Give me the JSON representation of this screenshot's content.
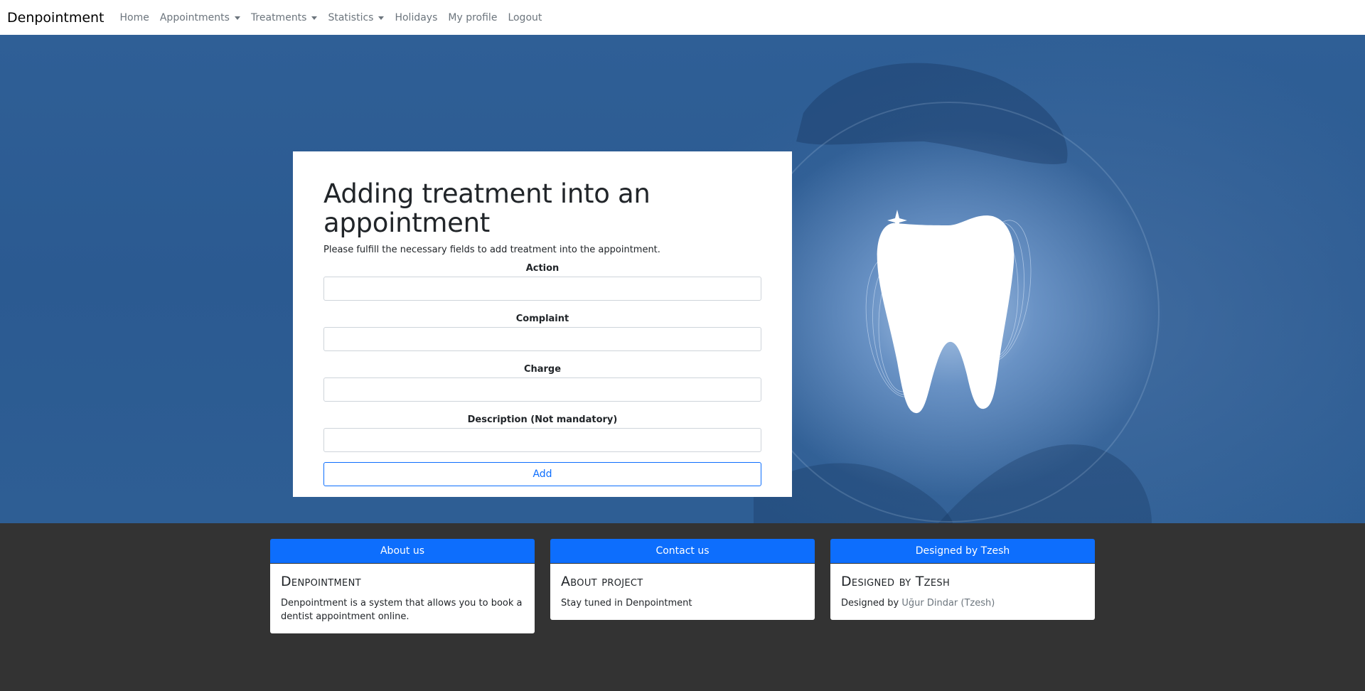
{
  "navbar": {
    "brand": "Denpointment",
    "items": [
      {
        "label": "Home",
        "dropdown": false
      },
      {
        "label": "Appointments",
        "dropdown": true
      },
      {
        "label": "Treatments",
        "dropdown": true
      },
      {
        "label": "Statistics",
        "dropdown": true
      },
      {
        "label": "Holidays",
        "dropdown": false
      },
      {
        "label": "My profile",
        "dropdown": false
      },
      {
        "label": "Logout",
        "dropdown": false
      }
    ]
  },
  "form": {
    "title": "Adding treatment into an appointment",
    "subtitle": "Please fulfill the necessary fields to add treatment into the appointment.",
    "fields": [
      {
        "label": "Action",
        "value": ""
      },
      {
        "label": "Complaint",
        "value": ""
      },
      {
        "label": "Charge",
        "value": ""
      },
      {
        "label": "Description (Not mandatory)",
        "value": ""
      }
    ],
    "submit_label": "Add"
  },
  "footer": {
    "cards": [
      {
        "header": "About us",
        "title": "Denpointment",
        "text": "Denpointment is a system that allows you to book a dentist appointment online."
      },
      {
        "header": "Contact us",
        "title": "About project",
        "text": "Stay tuned in Denpointment"
      },
      {
        "header": "Designed by Tzesh",
        "title": "Designed by Tzesh",
        "text_prefix": "Designed by ",
        "link_text": "Uğur Dindar (Tzesh)"
      }
    ]
  },
  "hero": {
    "illustration_icon": "tooth-icon"
  },
  "colors": {
    "primary": "#0d6efd",
    "hero_blue": "#2f5f96",
    "footer_bg": "#333333",
    "nav_text": "#6c757d"
  }
}
